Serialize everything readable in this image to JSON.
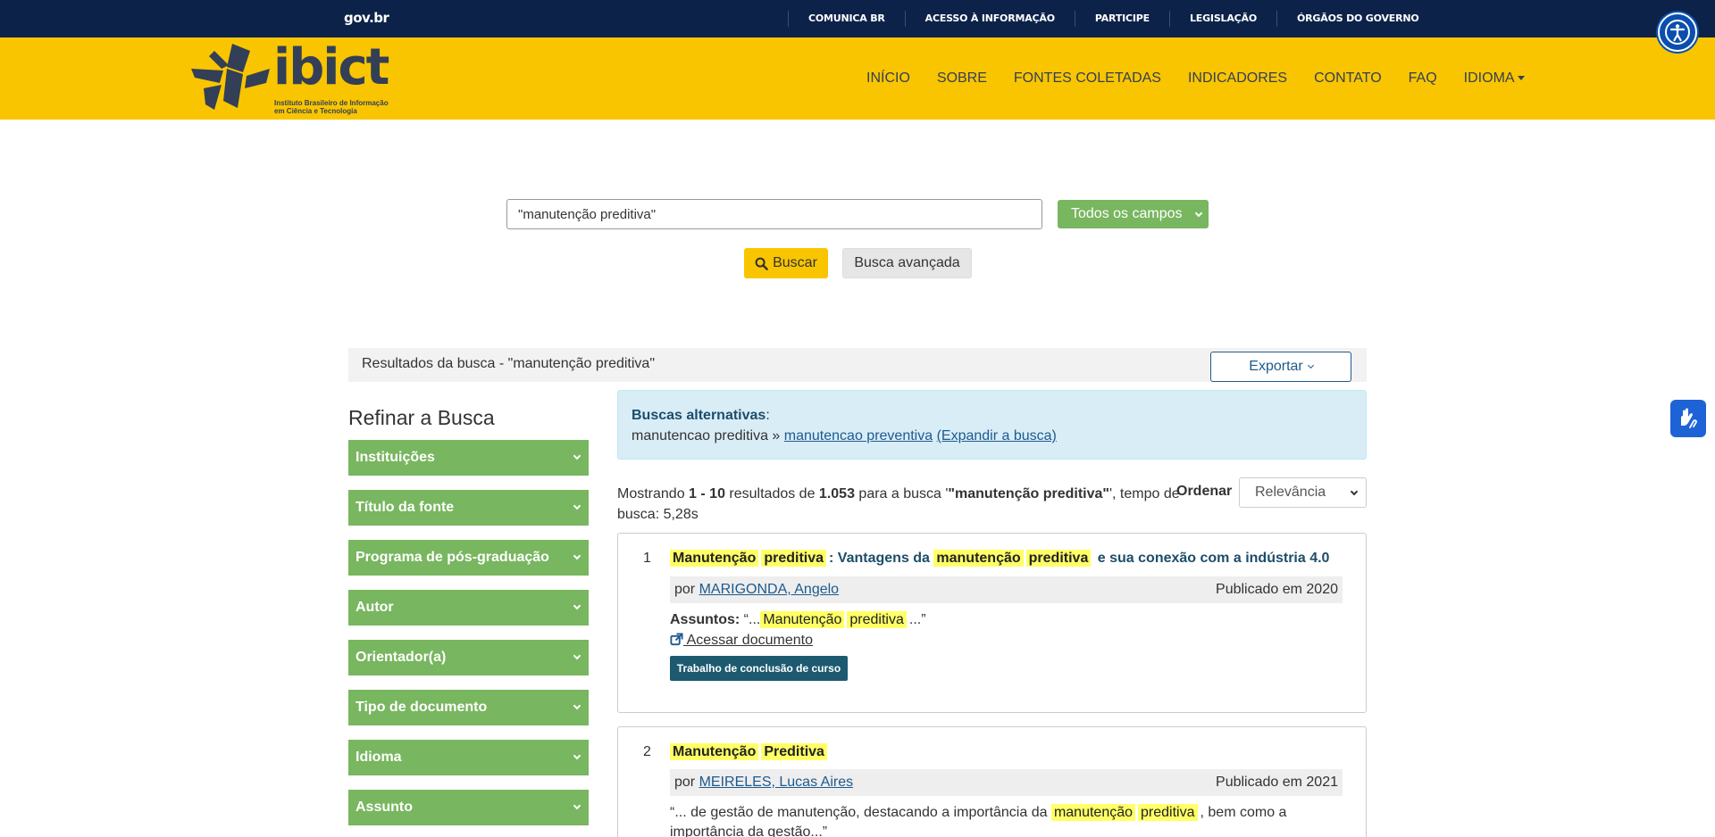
{
  "gov_bar": {
    "logo": "gov.br",
    "links": [
      "COMUNICA BR",
      "ACESSO À INFORMAÇÃO",
      "PARTICIPE",
      "LEGISLAÇÃO",
      "ÓRGÃOS DO GOVERNO"
    ]
  },
  "header": {
    "logo_word": "ibict",
    "logo_sub_1": "Instituto Brasileiro de Informação",
    "logo_sub_2": "em Ciência e Tecnologia",
    "nav": [
      "INÍCIO",
      "SOBRE",
      "FONTES COLETADAS",
      "INDICADORES",
      "CONTATO",
      "FAQ",
      "IDIOMA"
    ]
  },
  "search": {
    "query": "\"manutenção preditiva\"",
    "field": "Todos os campos",
    "buscar_label": "Buscar",
    "avancada_label": "Busca avançada"
  },
  "results_bar": {
    "title": "Resultados da busca - \"manutenção preditiva\"",
    "export_label": "Exportar"
  },
  "sidebar": {
    "title": "Refinar a Busca",
    "facets": [
      "Instituições",
      "Título da fonte",
      "Programa de pós-graduação",
      "Autor",
      "Orientador(a)",
      "Tipo de documento",
      "Idioma",
      "Assunto"
    ]
  },
  "alternatives": {
    "label": "Buscas alternativas",
    "colon": ":",
    "term": "manutencao preditiva",
    "sep": " » ",
    "suggestion": "manutencao preventiva",
    "expand": "(Expandir a busca)"
  },
  "stats": {
    "prefix": "Mostrando ",
    "range": "1 - 10",
    "mid1": " resultados de ",
    "total": "1.053",
    "mid2": " para a busca '",
    "query": "\"manutenção preditiva\"",
    "suffix": "', tempo de busca: 5,28s",
    "order_label": "Ordenar",
    "order_value": "Relevância"
  },
  "results": [
    {
      "num": "1",
      "title_hl1": "Manutenção",
      "title_hl2": "preditiva",
      "title_mid": ": Vantagens da ",
      "title_hl3": "manutenção",
      "title_hl4": "preditiva",
      "title_end": " e sua conexão com a indústria 4.0",
      "by": "por ",
      "author": "MARIGONDA, Angelo",
      "published": "Publicado em 2020",
      "subjects_label": "Assuntos:",
      "subjects_open": " “...",
      "subjects_hl1": "Manutenção",
      "subjects_hl2": "preditiva",
      "subjects_close": "...”",
      "access_label": " Acessar documento",
      "badge": "Trabalho de conclusão de curso"
    },
    {
      "num": "2",
      "title_hl1": "Manutenção",
      "title_hl2": "Preditiva",
      "by": "por ",
      "author": "MEIRELES, Lucas Aires",
      "published": "Publicado em 2021",
      "snippet_start": "“... de gestão de manutenção, destacando a importância da ",
      "snippet_hl1": "manutenção",
      "snippet_hl2": "preditiva",
      "snippet_end": ", bem como a",
      "snippet_line2": "importância da gestão...”"
    }
  ]
}
